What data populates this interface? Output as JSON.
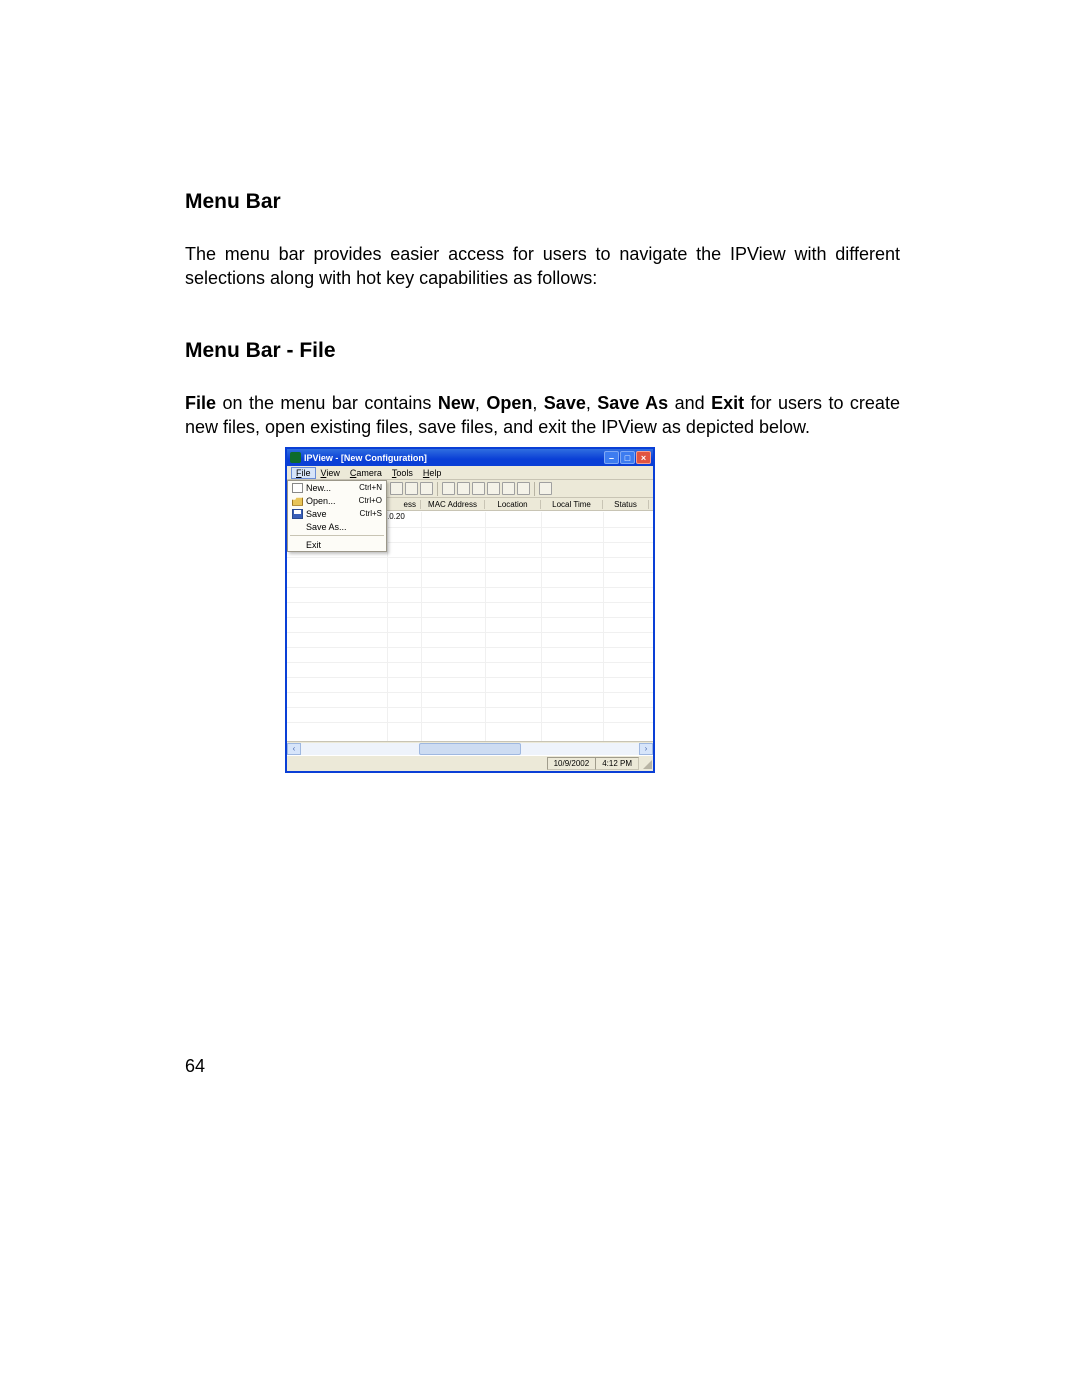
{
  "headings": {
    "h1": "Menu Bar",
    "h2": "Menu Bar - File"
  },
  "paragraph1": "The menu bar provides easier access for users to navigate the IPView with different selections along with hot key capabilities as follows:",
  "desc_parts": {
    "p1a": "File",
    "p1b": " on the menu bar contains ",
    "p1c": "New",
    "p1d": ", ",
    "p1e": "Open",
    "p1f": ", ",
    "p1g": "Save",
    "p1h": ", ",
    "p1i": "Save As",
    "p1j": " and ",
    "p1k": "Exit",
    "p1l": " for users to create new files, open existing files, save files, and exit the IPView as depicted below."
  },
  "page_number": "64",
  "window": {
    "title": "IPView - [New Configuration]",
    "menus": {
      "file": "File",
      "view": "View",
      "camera": "Camera",
      "tools": "Tools",
      "help": "Help"
    },
    "columns": {
      "col_peek": "ess",
      "mac": "MAC Address",
      "location": "Location",
      "localtime": "Local Time",
      "status": "Status"
    },
    "dropdown": {
      "new": {
        "label": "New...",
        "shortcut": "Ctrl+N"
      },
      "open": {
        "label": "Open...",
        "shortcut": "Ctrl+O"
      },
      "save": {
        "label": "Save",
        "shortcut": "Ctrl+S"
      },
      "saveas": {
        "label": "Save As..."
      },
      "exit": {
        "label": "Exit"
      }
    },
    "row_ip": ".0.20",
    "status": {
      "date": "10/9/2002",
      "time": "4:12 PM"
    }
  }
}
